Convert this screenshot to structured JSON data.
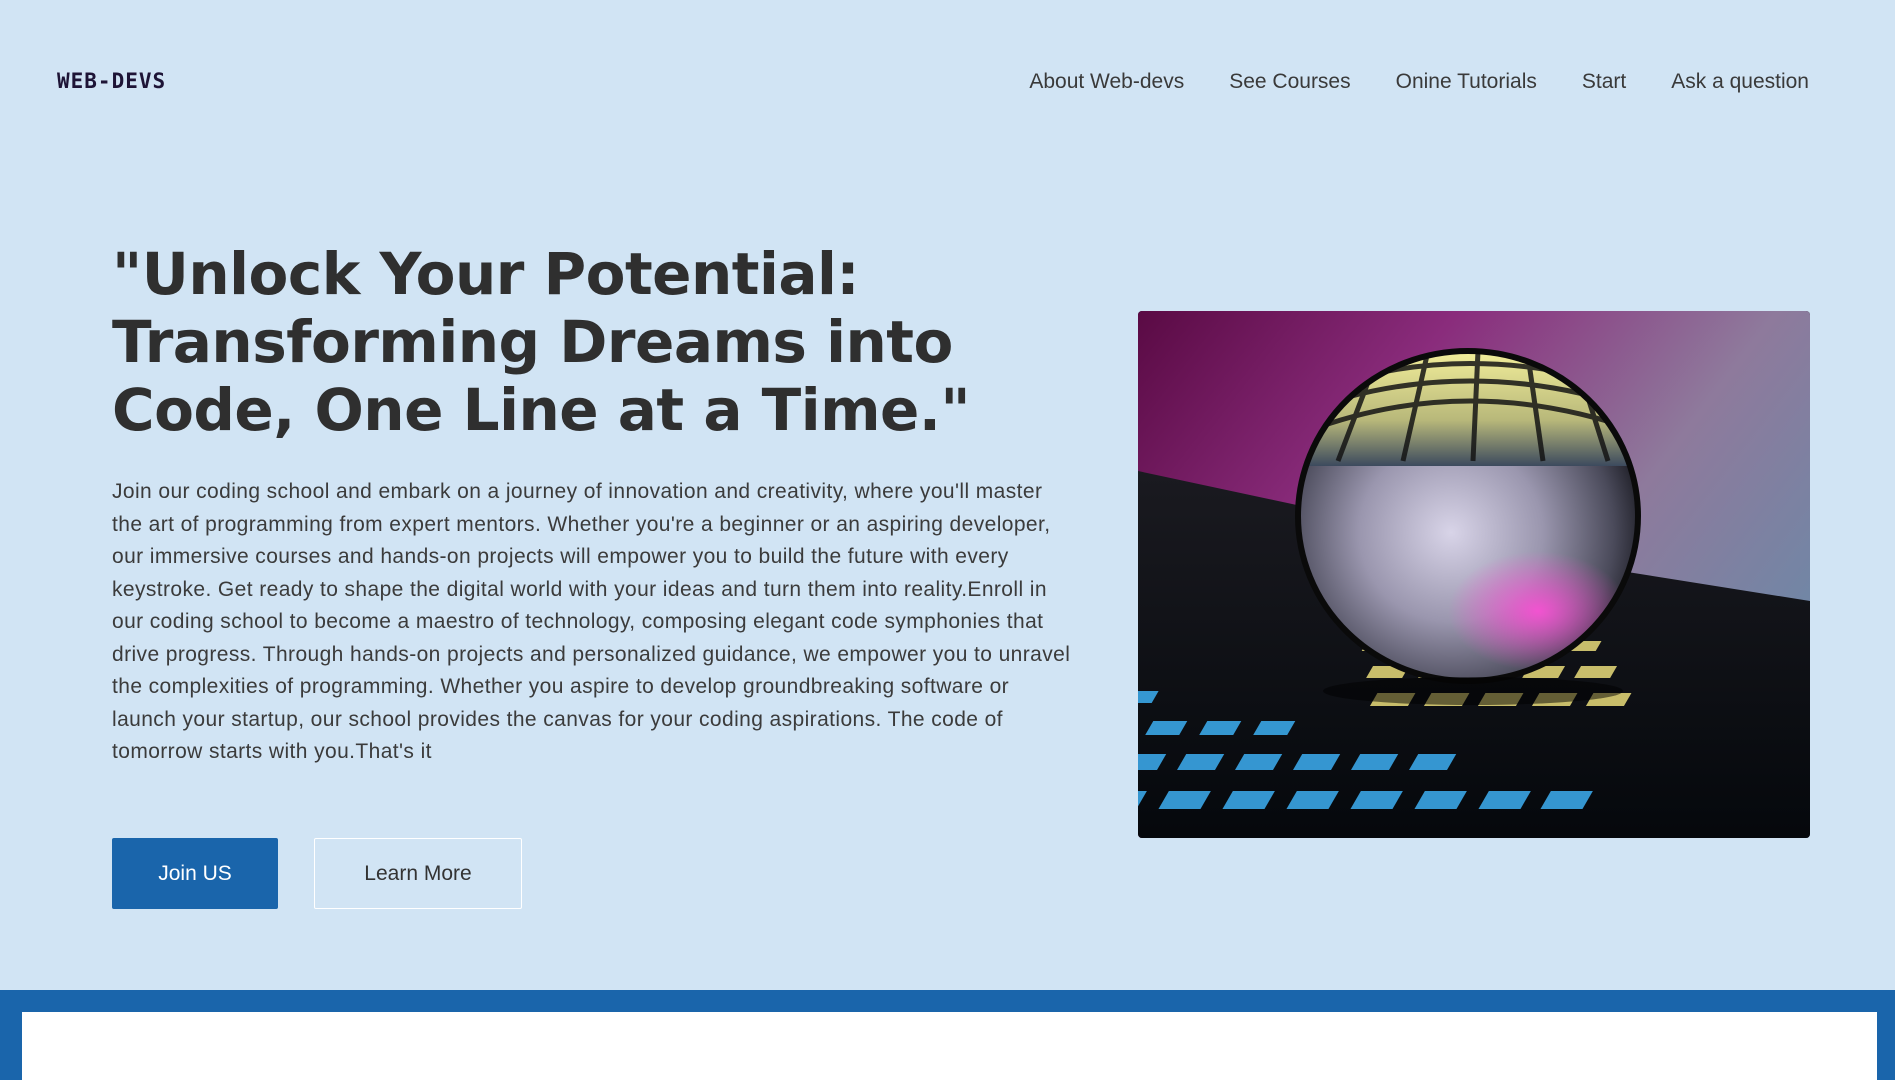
{
  "header": {
    "logo": "WEB-DEVS",
    "nav": [
      "About Web-devs",
      "See Courses",
      "Onine Tutorials",
      "Start",
      "Ask a question"
    ]
  },
  "hero": {
    "headline": "\"Unlock Your Potential: Transforming Dreams into Code, One Line at a Time.\"",
    "body": "Join our coding school and embark on a journey of innovation and creativity, where you'll master the art of programming from expert mentors. Whether you're a beginner or an aspiring developer, our immersive courses and hands-on projects will empower you to build the future with every keystroke. Get ready to shape the digital world with your ideas and turn them into reality.Enroll in our coding school to become a maestro of technology, composing elegant code symphonies that drive progress. Through hands-on projects and personalized guidance, we empower you to unravel the complexities of programming. Whether you aspire to develop groundbreaking software or launch your startup, our school provides the canvas for your coding aspirations. The code of tomorrow starts with you.That's it",
    "primary_button": "Join US",
    "secondary_button": "Learn More"
  },
  "colors": {
    "background": "#d1e4f4",
    "accent": "#1a65ab",
    "text": "#333333"
  }
}
